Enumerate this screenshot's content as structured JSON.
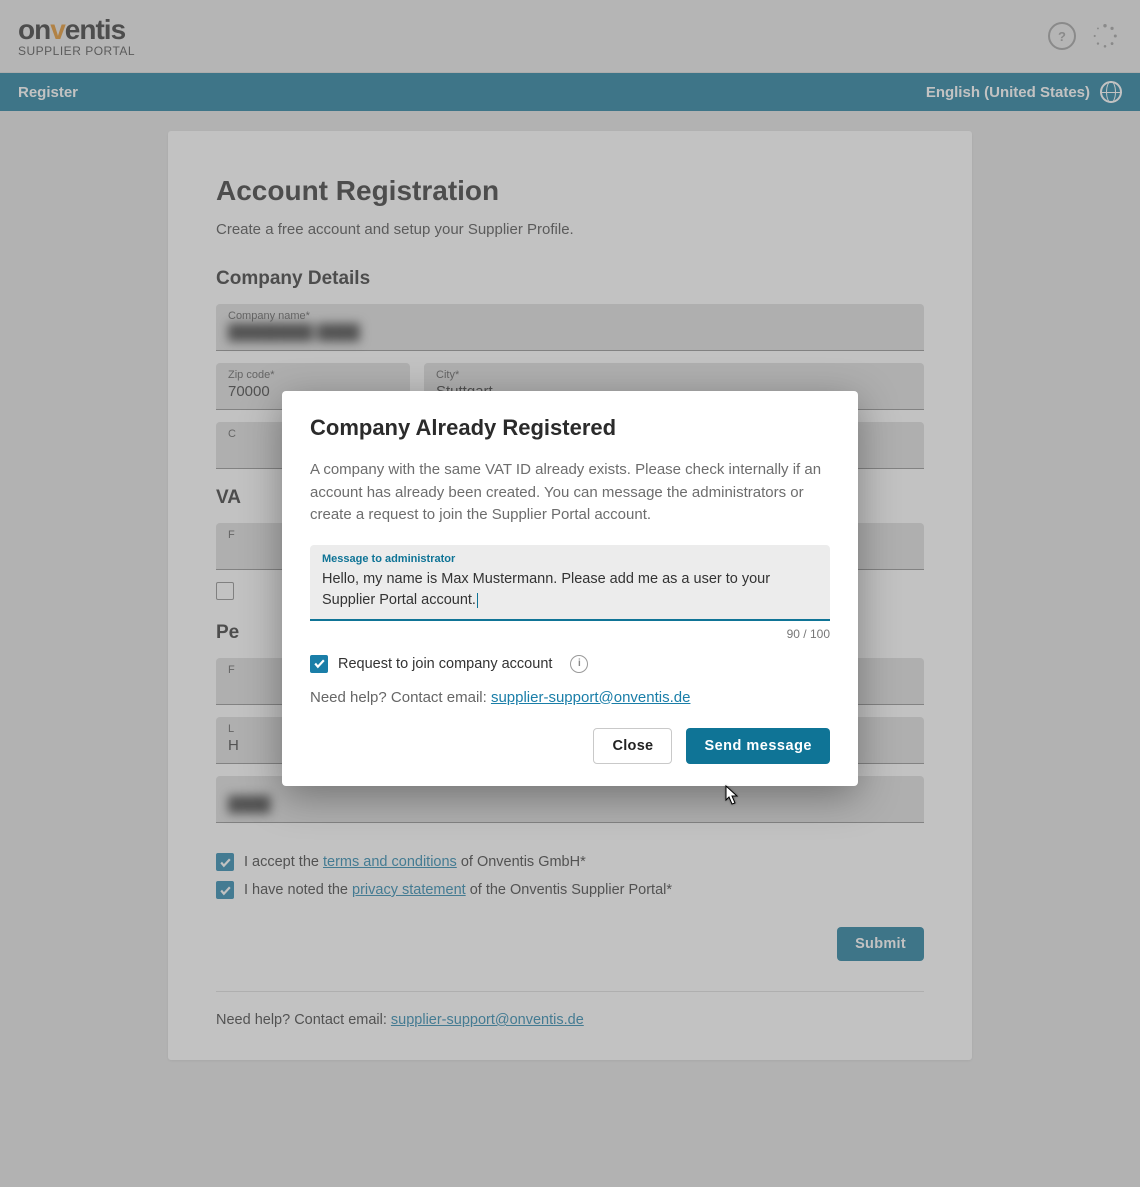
{
  "brand": {
    "name_a": "on",
    "name_accent": "v",
    "name_b": "entis",
    "subtitle": "SUPPLIER PORTAL"
  },
  "nav": {
    "left": "Register",
    "language": "English (United States)"
  },
  "page": {
    "title": "Account Registration",
    "lead": "Create a free account and setup your Supplier Profile.",
    "section_company": "Company Details",
    "section_personal": "Pe",
    "help_prefix": "Need help? Contact email: ",
    "help_email": "supplier-support@onventis.de"
  },
  "fields": {
    "company_name": {
      "label": "Company name*",
      "value": "████████ ████"
    },
    "zip": {
      "label": "Zip code*",
      "value": "70000"
    },
    "city": {
      "label": "City*",
      "value": "Stuttgart"
    },
    "c": {
      "label": "C",
      "value": ""
    },
    "vat_heading": "VA",
    "f1": {
      "label": "F",
      "value": ""
    },
    "l": {
      "label": "L",
      "value": ""
    },
    "h": {
      "label": "",
      "value": "H"
    },
    "email": {
      "label": "",
      "value": "████"
    }
  },
  "consent": {
    "terms_pre": "I accept the ",
    "terms_link": "terms and conditions",
    "terms_post": " of Onventis GmbH*",
    "privacy_pre": "I have noted the ",
    "privacy_link": "privacy statement",
    "privacy_post": " of the Onventis Supplier Portal*"
  },
  "buttons": {
    "submit": "Submit"
  },
  "modal": {
    "title": "Company Already Registered",
    "body": "A company with the same VAT ID already exists. Please check internally if an account has already been created. You can message the administrators or create a request to join the Supplier Portal account.",
    "msg_label": "Message to administrator",
    "msg_value": "Hello, my name is Max Mustermann. Please add me as a user to your Supplier Portal account.",
    "counter": "90 / 100",
    "join_label": "Request to join company account",
    "help_prefix": "Need help? Contact email: ",
    "help_email": "supplier-support@onventis.de",
    "close": "Close",
    "send": "Send message"
  }
}
